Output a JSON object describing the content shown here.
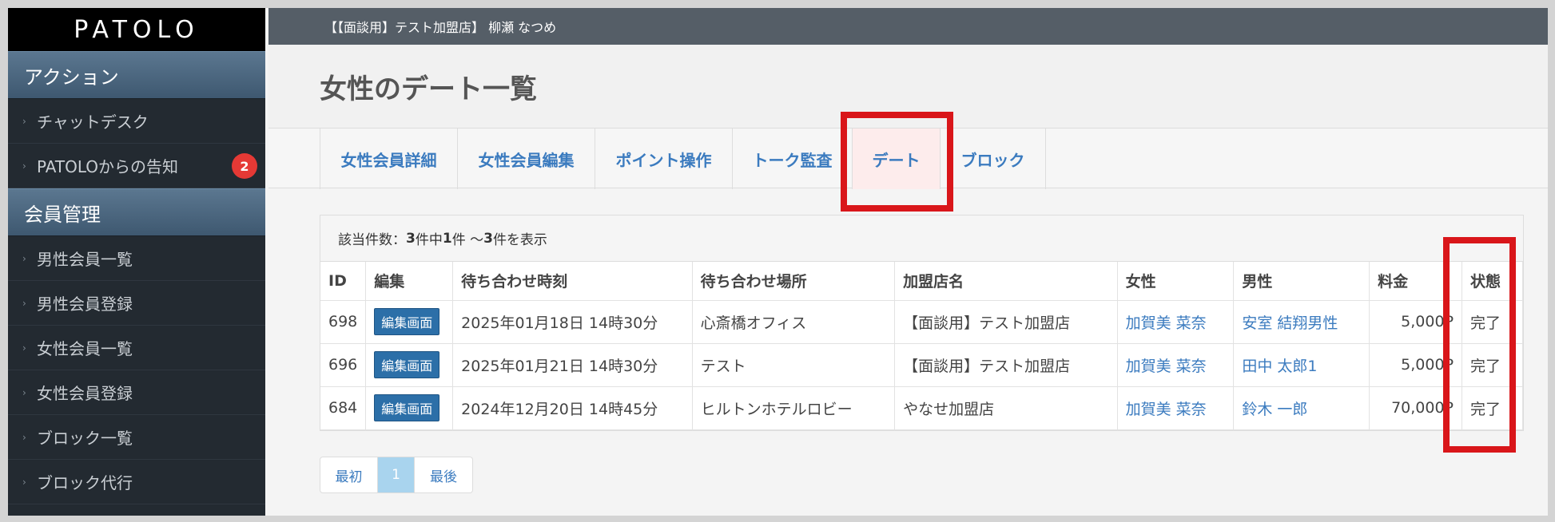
{
  "sidebar": {
    "logo": "PATOLO",
    "sections": [
      {
        "title": "アクション",
        "items": [
          {
            "label": "チャットデスク"
          },
          {
            "label": "PATOLOからの告知",
            "badge": "2"
          }
        ]
      },
      {
        "title": "会員管理",
        "items": [
          {
            "label": "男性会員一覧"
          },
          {
            "label": "男性会員登録"
          },
          {
            "label": "女性会員一覧"
          },
          {
            "label": "女性会員登録"
          },
          {
            "label": "ブロック一覧"
          },
          {
            "label": "ブロック代行"
          }
        ]
      }
    ]
  },
  "header": {
    "account": "【【面談用】テスト加盟店】 柳瀬 なつめ"
  },
  "page": {
    "title": "女性のデート一覧"
  },
  "tabs": [
    {
      "label": "女性会員詳細"
    },
    {
      "label": "女性会員編集"
    },
    {
      "label": "ポイント操作"
    },
    {
      "label": "トーク監査"
    },
    {
      "label": "デート",
      "active": true
    },
    {
      "label": "ブロック"
    }
  ],
  "results": {
    "prefix": "該当件数：",
    "total": "3",
    "mid1": "件中 ",
    "from": "1",
    "mid2": "件 〜 ",
    "to": "3",
    "suffix": "件を表示"
  },
  "table": {
    "columns": [
      "ID",
      "編集",
      "待ち合わせ時刻",
      "待ち合わせ場所",
      "加盟店名",
      "女性",
      "男性",
      "料金",
      "状態"
    ],
    "edit_label": "編集画面",
    "rows": [
      {
        "id": "698",
        "time": "2025年01月18日 14時30分",
        "place": "心斎橋オフィス",
        "store": "【面談用】テスト加盟店",
        "female": "加賀美 菜奈",
        "male": "安室 結翔男性",
        "fee": "5,000P",
        "status": "完了"
      },
      {
        "id": "696",
        "time": "2025年01月21日 14時30分",
        "place": "テスト",
        "store": "【面談用】テスト加盟店",
        "female": "加賀美 菜奈",
        "male": "田中 太郎1",
        "fee": "5,000P",
        "status": "完了"
      },
      {
        "id": "684",
        "time": "2024年12月20日 14時45分",
        "place": "ヒルトンホテルロビー",
        "store": "やなせ加盟店",
        "female": "加賀美 菜奈",
        "male": "鈴木 一郎",
        "fee": "70,000P",
        "status": "完了"
      }
    ]
  },
  "pager": {
    "first": "最初",
    "current": "1",
    "last": "最後"
  },
  "colors": {
    "accent": "#3b7bbf",
    "highlight": "#d9161a",
    "badge": "#e53935"
  }
}
